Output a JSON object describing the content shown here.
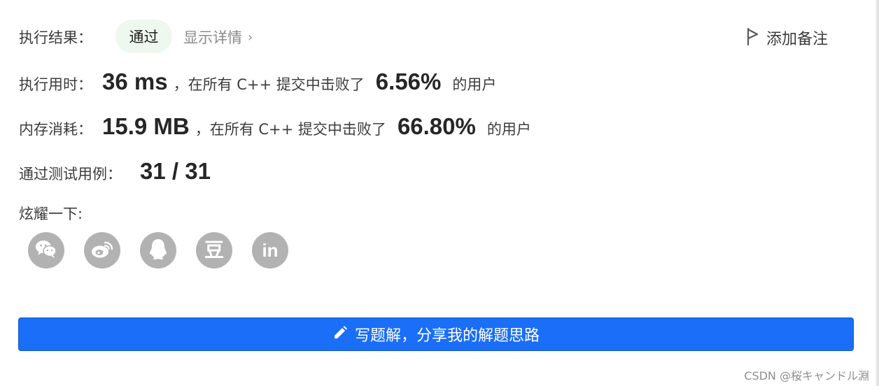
{
  "result": {
    "label": "执行结果：",
    "status": "通过",
    "details_link": "显示详情",
    "details_chevron": "›",
    "add_note": "添加备注"
  },
  "runtime": {
    "label": "执行用时：",
    "value": "36 ms",
    "text": "，在所有 C++ 提交中击败了",
    "percent": "6.56%",
    "suffix": "的用户"
  },
  "memory": {
    "label": "内存消耗：",
    "value": "15.9 MB",
    "text": "，在所有 C++ 提交中击败了",
    "percent": "66.80%",
    "suffix": "的用户"
  },
  "testcases": {
    "label": "通过测试用例：",
    "value": "31 / 31"
  },
  "share": {
    "label": "炫耀一下:",
    "items": [
      {
        "name": "wechat",
        "icon": "wechat-icon"
      },
      {
        "name": "weibo",
        "icon": "weibo-icon"
      },
      {
        "name": "qq",
        "icon": "qq-icon"
      },
      {
        "name": "douban",
        "icon": "douban-icon",
        "glyph": "豆"
      },
      {
        "name": "linkedin",
        "icon": "linkedin-icon",
        "glyph": "in"
      }
    ]
  },
  "solution_button": {
    "label": "写题解，分享我的解题思路",
    "icon": "pencil-icon"
  },
  "watermark": "CSDN @桜キャンドル淵",
  "colors": {
    "accent": "#1a6ef8",
    "badge_bg": "#eef8ee",
    "icon_gray": "#b2b2b2"
  }
}
